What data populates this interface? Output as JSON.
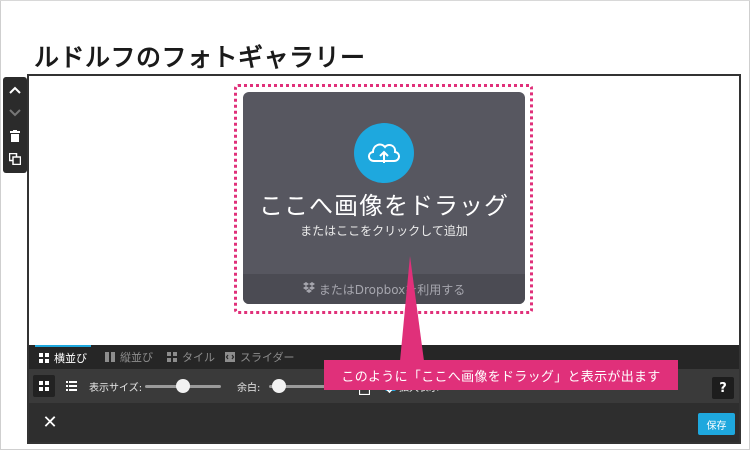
{
  "gallery": {
    "title": "ルドルフのフォトギャラリー"
  },
  "side_toolbar": {
    "icons": [
      "chevron-up-icon",
      "chevron-down-icon",
      "trash-icon",
      "copy-icon"
    ]
  },
  "dropzone": {
    "main_text": "ここへ画像をドラッグ",
    "sub_text": "またはここをクリックして追加",
    "footer_text": "またはDropboxを利用する",
    "icon": "cloud-upload-icon"
  },
  "tabs": [
    {
      "label": "横並び",
      "icon": "horizontal-layout-icon",
      "active": true
    },
    {
      "label": "縦並び",
      "icon": "vertical-layout-icon",
      "active": false
    },
    {
      "label": "タイル",
      "icon": "tile-layout-icon",
      "active": false
    },
    {
      "label": "スライダー",
      "icon": "slider-layout-icon",
      "active": false
    }
  ],
  "controls": {
    "display_size_label": "表示サイズ:",
    "margin_label": "余白:",
    "enlarge_label": "拡大表示",
    "help_label": "?",
    "enlarge_checked": true
  },
  "actions": {
    "close_label": "✕",
    "save_label": "保存"
  },
  "callout": {
    "text": "このように「ここへ画像をドラッグ」と表示が出ます"
  },
  "colors": {
    "accent": "#1ea8de",
    "callout": "#e0307a",
    "dropzone_bg": "#575760"
  }
}
